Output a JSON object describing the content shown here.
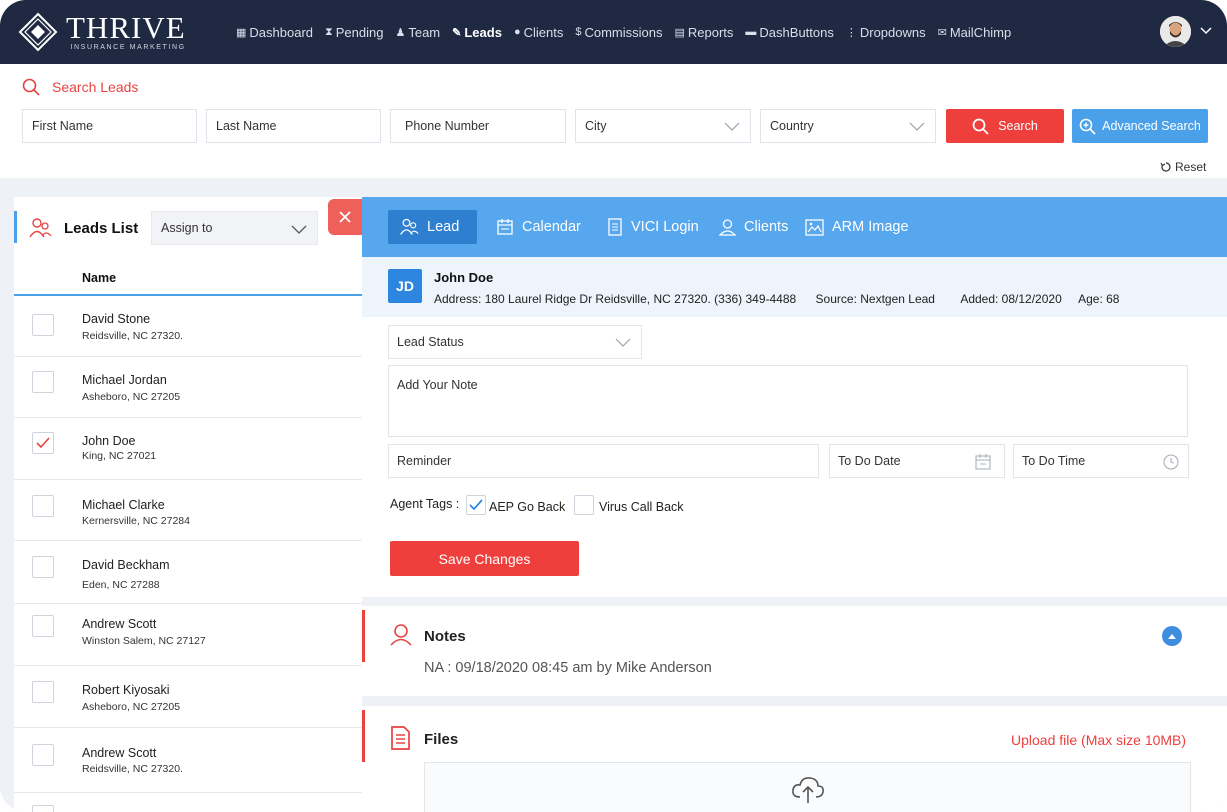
{
  "brand": {
    "name": "THRIVE",
    "tagline": "INSURANCE MARKETING"
  },
  "nav": {
    "items": [
      {
        "label": "Dashboard",
        "icon": "dashboard-icon",
        "glyph": "▦"
      },
      {
        "label": "Pending",
        "icon": "hourglass-icon",
        "glyph": "⧗"
      },
      {
        "label": "Team",
        "icon": "team-icon",
        "glyph": "♟"
      },
      {
        "label": "Leads",
        "icon": "leads-icon",
        "glyph": "✎",
        "active": true
      },
      {
        "label": "Clients",
        "icon": "user-icon",
        "glyph": "●"
      },
      {
        "label": "Commissions",
        "icon": "dollar-icon",
        "glyph": "$"
      },
      {
        "label": "Reports",
        "icon": "report-icon",
        "glyph": "▤"
      },
      {
        "label": "DashButtons",
        "icon": "buttons-icon",
        "glyph": "▬"
      },
      {
        "label": "Dropdowns",
        "icon": "dropdown-icon",
        "glyph": "⋮"
      },
      {
        "label": "MailChimp",
        "icon": "mail-icon",
        "glyph": "✉"
      }
    ]
  },
  "search": {
    "title": "Search Leads",
    "first_name": "First Name",
    "last_name": "Last Name",
    "phone": "Phone Number",
    "city": "City",
    "country": "Country",
    "search_btn": "Search",
    "advanced_btn": "Advanced Search",
    "reset": "Reset"
  },
  "leads_list": {
    "title": "Leads List",
    "assign_to": "Assign to",
    "column_name": "Name",
    "rows": [
      {
        "name": "David Stone",
        "address": "Reidsville, NC 27320.",
        "checked": false
      },
      {
        "name": "Michael Jordan",
        "address": "Asheboro, NC 27205",
        "checked": false
      },
      {
        "name": "John Doe",
        "address": "King, NC 27021",
        "checked": true
      },
      {
        "name": "Michael Clarke",
        "address": "Kernersville, NC 27284",
        "checked": false
      },
      {
        "name": "David Beckham",
        "address": "Eden, NC 27288",
        "checked": false
      },
      {
        "name": "Andrew Scott",
        "address": "Winston Salem, NC 27127",
        "checked": false
      },
      {
        "name": "Robert Kiyosaki",
        "address": "Asheboro, NC 27205",
        "checked": false
      },
      {
        "name": "Andrew Scott",
        "address": "Reidsville, NC 27320.",
        "checked": false
      }
    ]
  },
  "tabs": [
    {
      "label": "Lead",
      "icon": "lead-icon",
      "active": true
    },
    {
      "label": "Calendar",
      "icon": "calendar-icon"
    },
    {
      "label": "VICI Login",
      "icon": "document-icon"
    },
    {
      "label": "Clients",
      "icon": "clients-icon"
    },
    {
      "label": "ARM Image",
      "icon": "image-icon"
    }
  ],
  "lead": {
    "initials": "JD",
    "name": "John Doe",
    "address": "Address: 180 Laurel Ridge Dr Reidsville, NC 27320.  (336) 349-4488",
    "source": "Source: Nextgen Lead",
    "added": "Added: 08/12/2020",
    "age": "Age: 68"
  },
  "form": {
    "lead_status": "Lead Status",
    "note_placeholder": "Add Your Note",
    "reminder": "Reminder",
    "todo_date": "To Do Date",
    "todo_time": "To Do Time",
    "agent_tags_label": "Agent Tags :",
    "tags": [
      {
        "label": "AEP Go Back",
        "checked": true
      },
      {
        "label": "Virus Call Back",
        "checked": false
      }
    ],
    "save": "Save Changes"
  },
  "notes": {
    "title": "Notes",
    "entry": "NA : 09/18/2020 08:45 am by Mike Anderson"
  },
  "files": {
    "title": "Files",
    "upload_link": "Upload file (Max size 10MB)"
  },
  "colors": {
    "nav_bg": "#1f2942",
    "accent_red": "#ee3f3c",
    "accent_blue": "#4aa1ea",
    "tab_bar": "#56a7ee",
    "tab_active": "#2f7fd0"
  }
}
